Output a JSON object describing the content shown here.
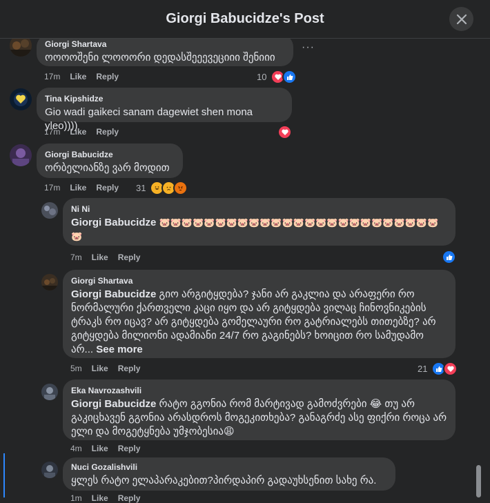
{
  "header": {
    "title": "Giorgi Babucidze's Post"
  },
  "comments": [
    {
      "author": "Giorgi Shartava",
      "text": "ოოოოშენი ლოოორი დედასშეეევეციიი შენიიი",
      "time": "17m",
      "like": "Like",
      "reply": "Reply",
      "react_count": "10",
      "more": "···"
    },
    {
      "author": "Tina Kipshidze",
      "text": "Gio wadi gaikeci sanam dagewiet shen mona yleo))))",
      "time": "17m",
      "like": "Like",
      "reply": "Reply"
    },
    {
      "author": "Giorgi Babucidze",
      "text": "ორბელიანზე ვარ მოდით",
      "time": "17m",
      "like": "Like",
      "reply": "Reply",
      "react_count": "31"
    },
    {
      "author": "Ni Ni",
      "mention": "Giorgi Babucidze",
      "text": "🐷🐷🐷🐷🐷🐷🐷🐷🐷🐷🐷🐷🐷🐷🐷🐷🐷🐷🐷🐷🐷🐷🐷🐷🐷🐷",
      "time": "7m",
      "like": "Like",
      "reply": "Reply"
    },
    {
      "author": "Giorgi Shartava",
      "mention": "Giorgi Babucidze",
      "text": "გიო არგიტყდება? ჯანი არ გაკლია და არაფერი რო ნორმალური ქართველი კაცი იყო და არ გიტყდება ვილაც ჩინოვნიკების ტრაკს რო იცავ? არ გიტყდება გომელაური რო გატრიალებს თითებზე? არ გიტყდება მილიონი ადამიანი 24/7 რო გაგინებს? ხოიცით რო სამუდამო არ...",
      "see_more": "See more",
      "time": "5m",
      "like": "Like",
      "reply": "Reply",
      "react_count": "21"
    },
    {
      "author": "Eka Navrozashvili",
      "mention": "Giorgi Babucidze",
      "text": "რატო გგონია რომ მარტივად გამოძვრები 😂 თუ არ გაკიცხავენ გგონია არასდროს მოგეკითხება? განაგრძე ასე ფიქრი როცა არ ელი და მოგეტყნება უმჯობესია😩",
      "time": "4m",
      "like": "Like",
      "reply": "Reply"
    },
    {
      "author": "Nuci Gozalishvili",
      "text": "ყლეს რატო ელაპარაკებით?პირდაპირ გადაუხსენით სახე რა.",
      "time": "1m",
      "like": "Like",
      "reply": "Reply"
    }
  ],
  "reactions": {
    "like_color": "#1877f2",
    "love_color": "#f33e58",
    "haha_color": "#f7b125",
    "angry_color": "#e9710f"
  }
}
